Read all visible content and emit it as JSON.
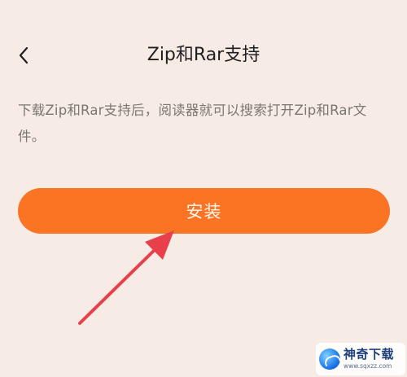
{
  "header": {
    "back_icon": "chevron-left-icon",
    "title": "Zip和Rar支持"
  },
  "main": {
    "description": "下载Zip和Rar支持后，阅读器就可以搜索打开Zip和Rar文件。",
    "install_label": "安装"
  },
  "annotation": {
    "arrow_color": "#e8404a"
  },
  "watermark": {
    "name": "神奇下载",
    "url": "www.sqxzz.com"
  },
  "colors": {
    "background": "#f7ebe6",
    "accent": "#fb7424",
    "title_text": "#1f1f1f",
    "body_text": "#7a7773"
  }
}
